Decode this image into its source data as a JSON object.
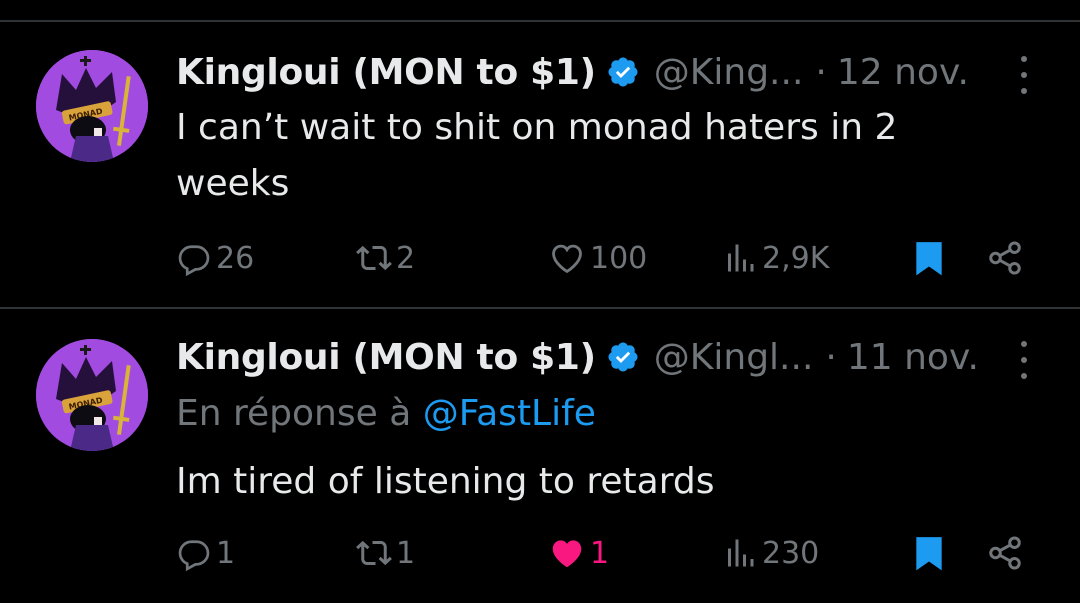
{
  "colors": {
    "background": "#000000",
    "text_primary": "#e7e9ea",
    "text_secondary": "#71767b",
    "accent_blue": "#1d9bf0",
    "like_pink": "#f91880",
    "divider": "#2f3336",
    "avatar_purple": "#a24be0"
  },
  "tweets": [
    {
      "author_name": "Kingloui (MON to $1)",
      "handle": "@King...",
      "separator": "·",
      "date": "12 nov.",
      "text": "I can’t wait to shit on monad haters in 2 weeks",
      "replies": "26",
      "reposts": "2",
      "likes": "100",
      "views": "2,9K",
      "liked": false,
      "bookmarked": true
    },
    {
      "author_name": "Kingloui (MON to $1)",
      "handle": "@Kingl...",
      "separator": "·",
      "date": "11 nov.",
      "reply_prefix": "En réponse à",
      "reply_mention": "@FastLife",
      "text": "Im tired of listening to retards",
      "replies": "1",
      "reposts": "1",
      "likes": "1",
      "views": "230",
      "liked": true,
      "bookmarked": true
    }
  ],
  "avatar_text": "MONAD",
  "icons": {
    "verified": "verified-badge-icon",
    "more": "more-dots-icon",
    "reply": "reply-bubble-icon",
    "repost": "repost-arrows-icon",
    "like": "heart-icon",
    "views": "views-bars-icon",
    "bookmark": "bookmark-icon",
    "share": "share-icon"
  }
}
